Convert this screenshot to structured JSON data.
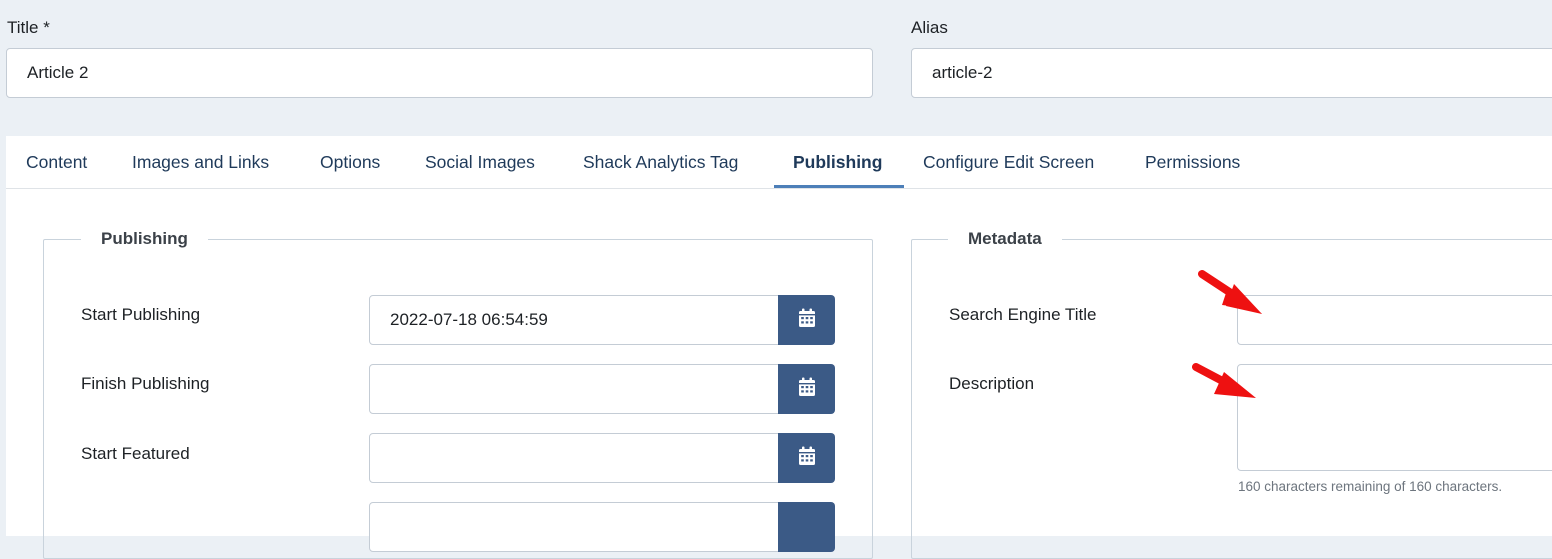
{
  "title_field": {
    "label": "Title *",
    "value": "Article 2"
  },
  "alias_field": {
    "label": "Alias",
    "value": "article-2"
  },
  "tabs": [
    {
      "label": "Content"
    },
    {
      "label": "Images and Links"
    },
    {
      "label": "Options"
    },
    {
      "label": "Social Images"
    },
    {
      "label": "Shack Analytics Tag"
    },
    {
      "label": "Publishing",
      "active": true
    },
    {
      "label": "Configure Edit Screen"
    },
    {
      "label": "Permissions"
    }
  ],
  "publishing": {
    "legend": "Publishing",
    "start_publishing": {
      "label": "Start Publishing",
      "value": "2022-07-18 06:54:59"
    },
    "finish_publishing": {
      "label": "Finish Publishing",
      "value": ""
    },
    "start_featured": {
      "label": "Start Featured",
      "value": ""
    },
    "finish_featured": {
      "value": ""
    }
  },
  "metadata": {
    "legend": "Metadata",
    "search_engine_title": {
      "label": "Search Engine Title",
      "value": ""
    },
    "description": {
      "label": "Description",
      "value": "",
      "hint": "160 characters remaining of 160 characters."
    }
  },
  "colors": {
    "page_bg": "#ebf0f5",
    "accent": "#3b5a86",
    "tab_active_underline": "#4d7fb8",
    "annotation_arrow": "#ee1111"
  },
  "icons": [
    "calendar-icon",
    "red-arrow-annotation"
  ]
}
